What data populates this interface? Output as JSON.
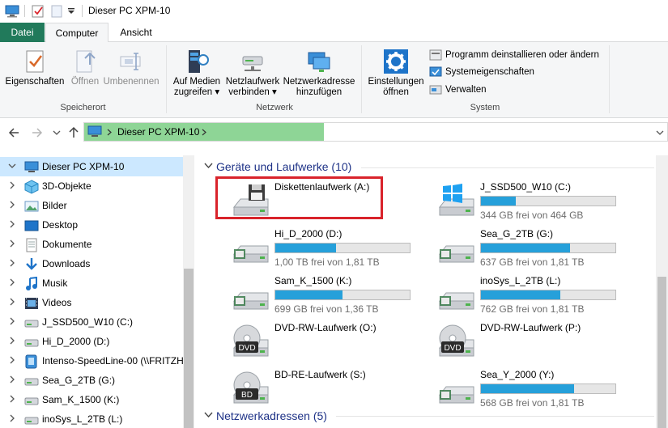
{
  "window": {
    "title": "Dieser PC XPM-10"
  },
  "tabs": [
    {
      "label": "Datei"
    },
    {
      "label": "Computer"
    },
    {
      "label": "Ansicht"
    }
  ],
  "ribbon": {
    "speicherort": {
      "label": "Speicherort",
      "eigenschaften": "Eigenschaften",
      "oeffnen": "Öffnen",
      "umbenennen": "Umbenennen"
    },
    "netzwerk": {
      "label": "Netzwerk",
      "medien_l1": "Auf Medien",
      "medien_l2": "zugreifen",
      "laufwerk_l1": "Netzlaufwerk",
      "laufwerk_l2": "verbinden",
      "adresse_l1": "Netzwerkadresse",
      "adresse_l2": "hinzufügen"
    },
    "system": {
      "label": "System",
      "einstellungen_l1": "Einstellungen",
      "einstellungen_l2": "öffnen",
      "programm": "Programm deinstallieren oder ändern",
      "systemeigenschaften": "Systemeigenschaften",
      "verwalten": "Verwalten"
    }
  },
  "address": {
    "path": "Dieser PC XPM-10"
  },
  "nav": [
    {
      "label": "Dieser PC XPM-10",
      "icon": "pc-icon"
    },
    {
      "label": "3D-Objekte",
      "icon": "3d-objects-icon"
    },
    {
      "label": "Bilder",
      "icon": "pictures-icon"
    },
    {
      "label": "Desktop",
      "icon": "desktop-icon"
    },
    {
      "label": "Dokumente",
      "icon": "documents-icon"
    },
    {
      "label": "Downloads",
      "icon": "downloads-icon"
    },
    {
      "label": "Musik",
      "icon": "music-icon"
    },
    {
      "label": "Videos",
      "icon": "videos-icon"
    },
    {
      "label": "J_SSD500_W10 (C:)",
      "icon": "drive-icon"
    },
    {
      "label": "Hi_D_2000 (D:)",
      "icon": "drive-icon"
    },
    {
      "label": "Intenso-SpeedLine-00 (\\\\FRITZH",
      "icon": "network-drive-icon"
    },
    {
      "label": "Sea_G_2TB (G:)",
      "icon": "drive-icon"
    },
    {
      "label": "Sam_K_1500 (K:)",
      "icon": "drive-icon"
    },
    {
      "label": "inoSys_L_2TB (L:)",
      "icon": "drive-icon"
    }
  ],
  "sections": {
    "devices": "Geräte und Laufwerke (10)",
    "network": "Netzwerkadressen (5)"
  },
  "drives": [
    {
      "name": "Diskettenlaufwerk (A:)",
      "icon": "floppy-icon"
    },
    {
      "name": "J_SSD500_W10 (C:)",
      "free": "344 GB frei von 464 GB",
      "used_fraction": 0.26,
      "icon": "windows-drive-icon"
    },
    {
      "name": "Hi_D_2000 (D:)",
      "free": "1,00 TB frei von 1,81 TB",
      "used_fraction": 0.45,
      "icon": "drive-icon"
    },
    {
      "name": "Sea_G_2TB (G:)",
      "free": "637 GB frei von 1,81 TB",
      "used_fraction": 0.66,
      "icon": "drive-icon"
    },
    {
      "name": "Sam_K_1500 (K:)",
      "free": "699 GB frei von 1,36 TB",
      "used_fraction": 0.5,
      "icon": "drive-icon"
    },
    {
      "name": "inoSys_L_2TB (L:)",
      "free": "762 GB frei von 1,81 TB",
      "used_fraction": 0.59,
      "icon": "drive-icon"
    },
    {
      "name": "DVD-RW-Laufwerk (O:)",
      "icon": "dvd-icon",
      "disc_label": "DVD"
    },
    {
      "name": "DVD-RW-Laufwerk (P:)",
      "icon": "dvd-icon",
      "disc_label": "DVD"
    },
    {
      "name": "BD-RE-Laufwerk (S:)",
      "icon": "bd-icon",
      "disc_label": "BD"
    },
    {
      "name": "Sea_Y_2000 (Y:)",
      "free": "568 GB frei von 1,81 TB",
      "used_fraction": 0.69,
      "icon": "drive-icon"
    }
  ],
  "colors": {
    "accent_tab": "#217a5b",
    "address_fill": "#8ed596",
    "usage_bar": "#26a0da",
    "highlight_box": "#d9232b",
    "section_text": "#1e3287"
  }
}
